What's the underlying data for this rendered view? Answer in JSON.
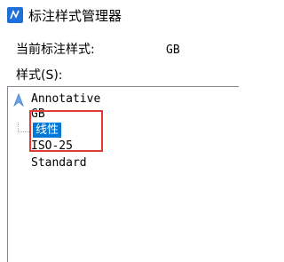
{
  "window": {
    "title": "标注样式管理器"
  },
  "current_style": {
    "label": "当前标注样式:",
    "value": "GB"
  },
  "styles_list": {
    "label": "样式(S):",
    "items": [
      {
        "label": "Annotative"
      },
      {
        "label": "GB",
        "children": [
          {
            "label": "线性"
          }
        ]
      },
      {
        "label": "ISO-25"
      },
      {
        "label": "Standard"
      }
    ]
  },
  "colors": {
    "selection": "#0078d7",
    "annotation_box": "#e53935"
  }
}
